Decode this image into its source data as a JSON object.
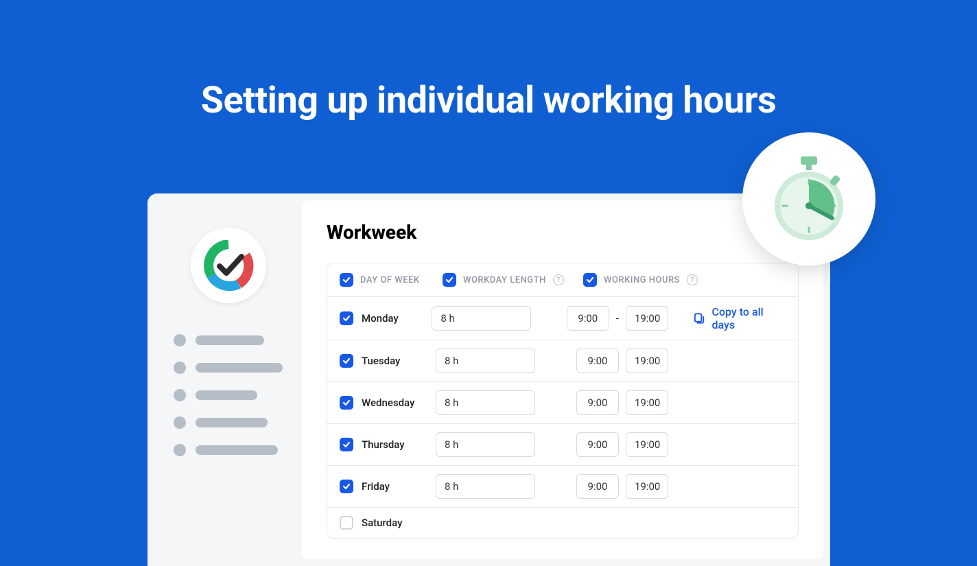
{
  "page_title": "Setting up individual working hours",
  "main": {
    "title": "Workweek"
  },
  "headers": {
    "day": "Day of week",
    "length": "Workday length",
    "hours": "Working hours"
  },
  "copy_action": "Copy to all days",
  "days": [
    {
      "name": "Monday",
      "checked": true,
      "length": "8 h",
      "start": "9:00",
      "end": "19:00",
      "show_dash": true,
      "show_copy": true
    },
    {
      "name": "Tuesday",
      "checked": true,
      "length": "8 h",
      "start": "9:00",
      "end": "19:00",
      "show_dash": false,
      "show_copy": false
    },
    {
      "name": "Wednesday",
      "checked": true,
      "length": "8 h",
      "start": "9:00",
      "end": "19:00",
      "show_dash": false,
      "show_copy": false
    },
    {
      "name": "Thursday",
      "checked": true,
      "length": "8 h",
      "start": "9:00",
      "end": "19:00",
      "show_dash": false,
      "show_copy": false
    },
    {
      "name": "Friday",
      "checked": true,
      "length": "8 h",
      "start": "9:00",
      "end": "19:00",
      "show_dash": false,
      "show_copy": false
    },
    {
      "name": "Saturday",
      "checked": false
    }
  ],
  "nav_bar_widths": [
    100,
    130,
    90,
    105,
    120
  ]
}
